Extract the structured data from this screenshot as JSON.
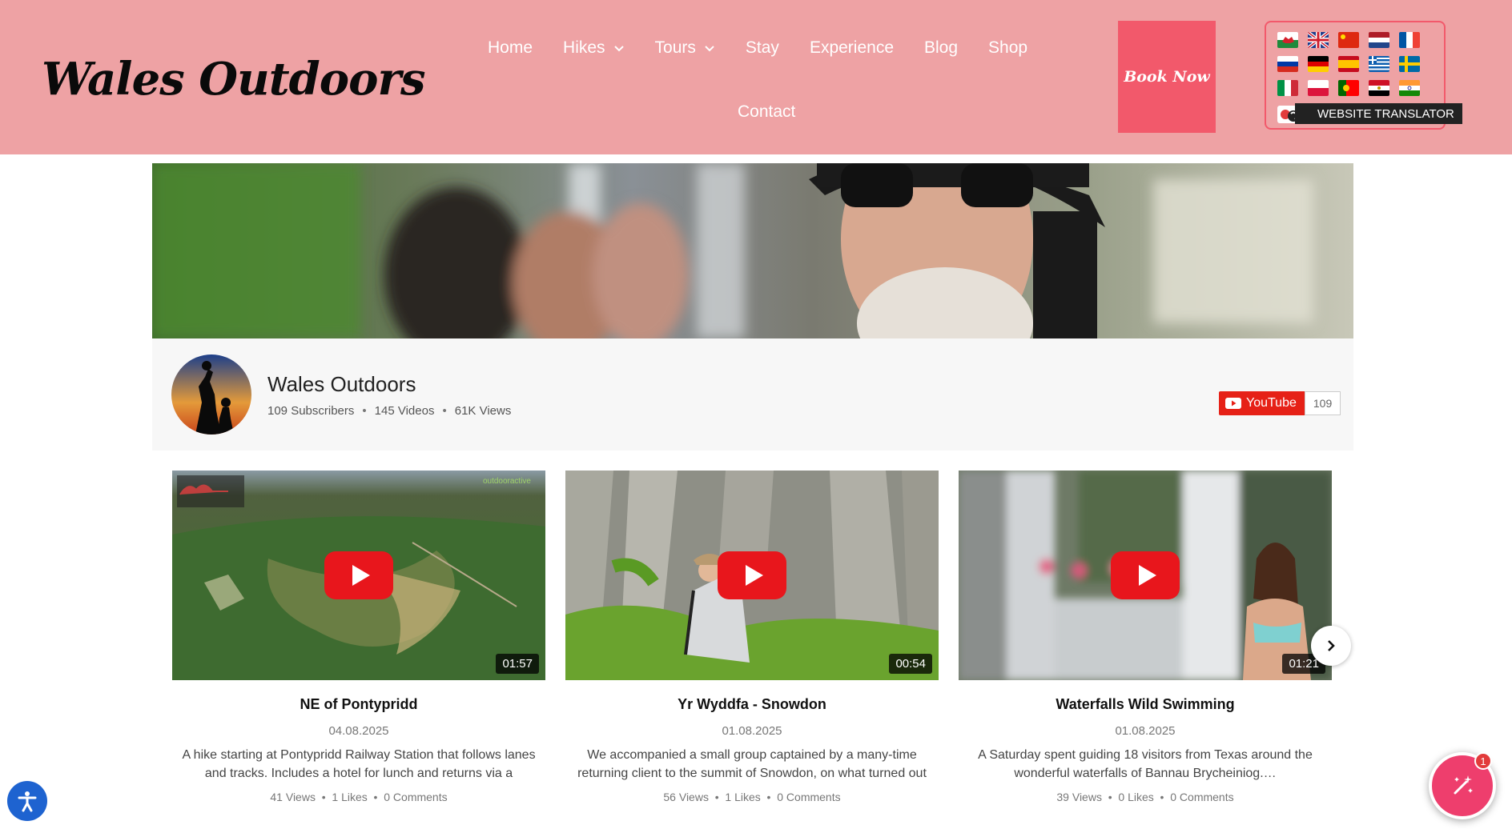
{
  "header": {
    "logo": "Wales Outdoors",
    "nav": [
      {
        "label": "Home",
        "has_dropdown": false
      },
      {
        "label": "Hikes",
        "has_dropdown": true
      },
      {
        "label": "Tours",
        "has_dropdown": true
      },
      {
        "label": "Stay",
        "has_dropdown": false
      },
      {
        "label": "Experience",
        "has_dropdown": false
      },
      {
        "label": "Blog",
        "has_dropdown": false
      },
      {
        "label": "Shop",
        "has_dropdown": false
      },
      {
        "label": "Contact",
        "has_dropdown": false
      }
    ],
    "book_now": "Book Now",
    "translator": {
      "label": "WEBSITE TRANSLATOR",
      "flags": [
        "wales-flag",
        "uk-flag",
        "china-flag",
        "netherlands-flag",
        "france-flag",
        "russia-flag",
        "germany-flag",
        "spain-flag",
        "greece-flag",
        "sweden-flag",
        "italy-flag",
        "poland-flag",
        "portugal-flag",
        "egypt-flag",
        "india-flag"
      ]
    },
    "colors": {
      "header_bg": "#eea2a4",
      "accent": "#f2596b"
    }
  },
  "channel": {
    "name": "Wales Outdoors",
    "subscribers": "109 Subscribers",
    "videos": "145 Videos",
    "views": "61K Views",
    "youtube_label": "YouTube",
    "youtube_count": "109"
  },
  "videos": [
    {
      "title": "NE of Pontypridd",
      "date": "04.08.2025",
      "duration": "01:57",
      "description": "A hike starting at Pontypridd Railway Station that follows lanes and tracks. Includes a hotel for lunch and returns via a hidden…",
      "views": "41 Views",
      "likes": "1 Likes",
      "comments": "0 Comments",
      "thumb_watermark": "outdooractive"
    },
    {
      "title": "Yr Wyddfa - Snowdon",
      "date": "01.08.2025",
      "duration": "00:54",
      "description": "We accompanied a small group captained by a many-time returning client to the summit of Snowdon, on what turned out t…",
      "views": "56 Views",
      "likes": "1 Likes",
      "comments": "0 Comments"
    },
    {
      "title": "Waterfalls Wild Swimming",
      "date": "01.08.2025",
      "duration": "01:21",
      "description": "A Saturday spent guiding 18 visitors from Texas around the wonderful waterfalls of Bannau Brycheiniog.…",
      "views": "39 Views",
      "likes": "0 Likes",
      "comments": "0 Comments"
    }
  ],
  "floating": {
    "magic_badge": "1"
  }
}
